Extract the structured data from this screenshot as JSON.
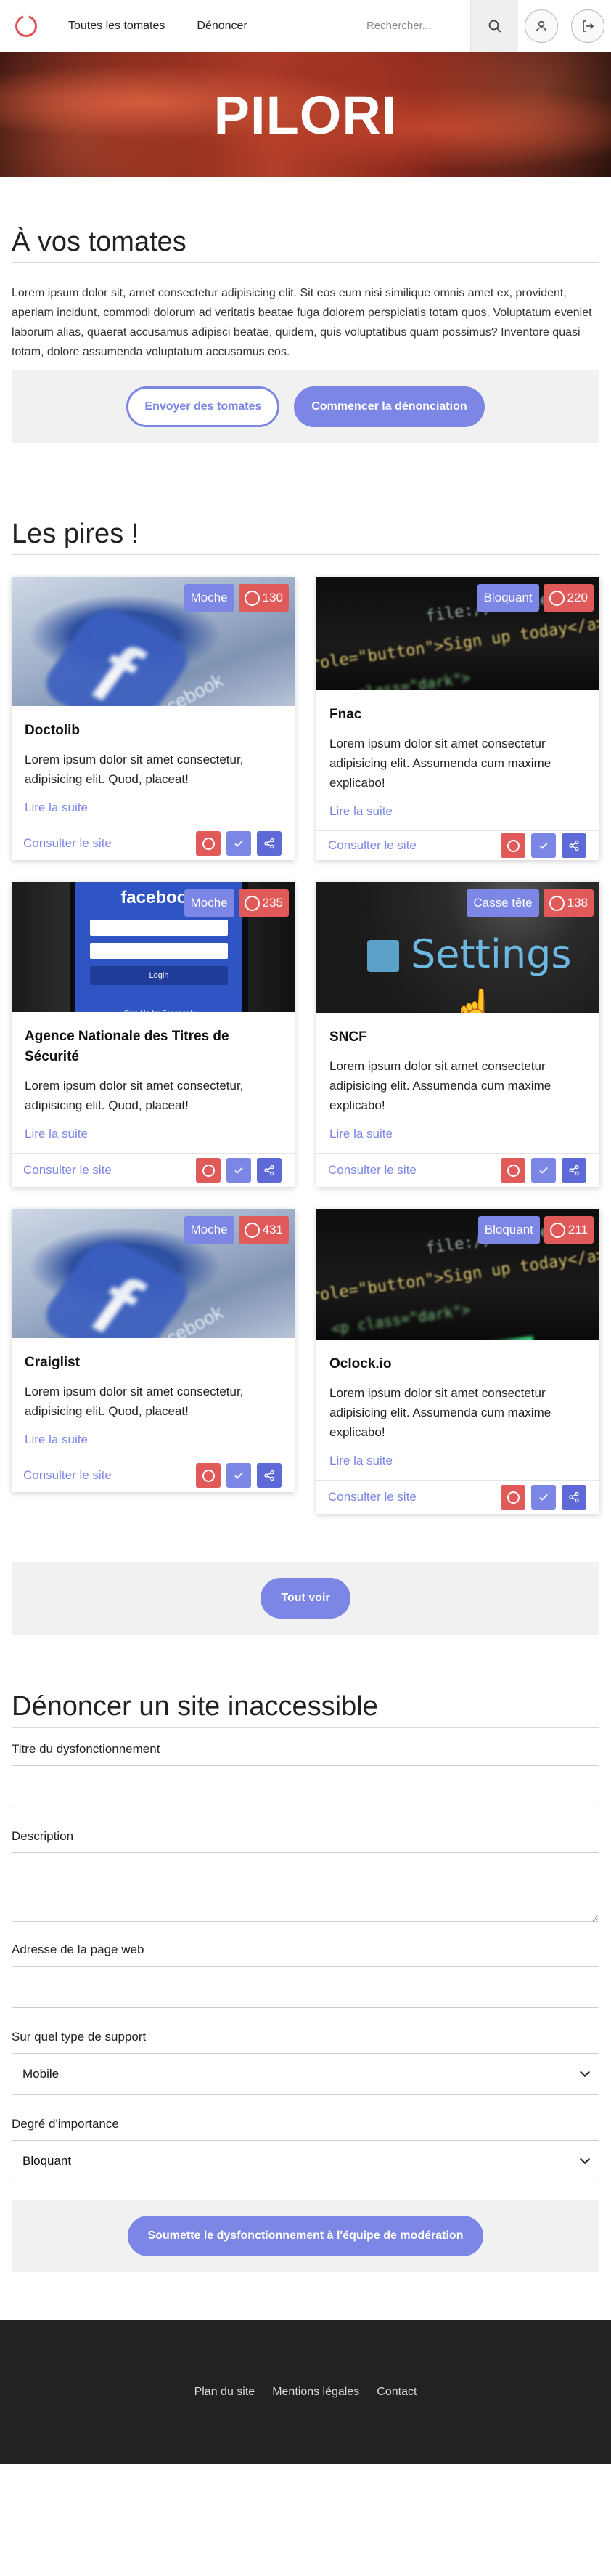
{
  "nav": {
    "links": [
      "Toutes les tomates",
      "Dénoncer"
    ],
    "search_placeholder": "Rechercher..."
  },
  "hero": {
    "title": "PILORI"
  },
  "intro": {
    "title": "À vos tomates",
    "text": "Lorem ipsum dolor sit, amet consectetur adipisicing elit. Sit eos eum nisi similique omnis amet ex, provident, aperiam incidunt, commodi dolorum ad veritatis beatae fuga dolorem perspiciatis totam quos. Voluptatum eveniet laborum alias, quaerat accusamus adipisci beatae, quidem, quis voluptatibus quam possimus? Inventore quasi totam, dolore assumenda voluptatum accusamus eos.",
    "btn_send": "Envoyer des tomates",
    "btn_start": "Commencer la dénonciation"
  },
  "worst": {
    "title": "Les pires !",
    "visit_label": "Consulter le site",
    "more_label": "Lire la suite",
    "see_all": "Tout voir",
    "cards": [
      {
        "title": "Doctolib",
        "category": "Moche",
        "count": "130",
        "desc": "Lorem ipsum dolor sit amet consectetur, adipisicing elit. Quod, placeat!",
        "image": "facebook-logo-photo"
      },
      {
        "title": "Fnac",
        "category": "Bloquant",
        "count": "220",
        "desc": "Lorem ipsum dolor sit amet consectetur adipisicing elit. Assumenda cum maxime explicabo!",
        "image": "code-screen-photo"
      },
      {
        "title": "Agence Nationale des Titres de Sécurité",
        "category": "Moche",
        "count": "235",
        "desc": "Lorem ipsum dolor sit amet consectetur, adipisicing elit. Quod, placeat!",
        "image": "phone-facebook-photo"
      },
      {
        "title": "SNCF",
        "category": "Casse tête",
        "count": "138",
        "desc": "Lorem ipsum dolor sit amet consectetur adipisicing elit. Assumenda cum maxime explicabo!",
        "image": "settings-screen-photo"
      },
      {
        "title": "Craiglist",
        "category": "Moche",
        "count": "431",
        "desc": "Lorem ipsum dolor sit amet consectetur, adipisicing elit. Quod, placeat!",
        "image": "facebook-logo-photo"
      },
      {
        "title": "Oclock.io",
        "category": "Bloquant",
        "count": "211",
        "desc": "Lorem ipsum dolor sit amet consectetur adipisicing elit. Assumenda cum maxime explicabo!",
        "image": "code-screen-photo"
      }
    ]
  },
  "report": {
    "title": "Dénoncer un site inaccessible",
    "label_title": "Titre du dysfonctionnement",
    "label_desc": "Description",
    "label_url": "Adresse de la page web",
    "label_support": "Sur quel type de support",
    "support_value": "Mobile",
    "label_importance": "Degré d'importance",
    "importance_value": "Bloquant",
    "submit": "Soumette le dysfonctionnement à l'équipe de modération"
  },
  "footer": {
    "links": [
      "Plan du site",
      "Mentions légales",
      "Contact"
    ]
  },
  "colors": {
    "accent": "#7c86e4",
    "danger": "#e05a5a",
    "footer": "#222224"
  },
  "code_lines": [
    "file://</code>",
    "role=\"button\">Sign up today</a>",
    "<p class=\"dark\">"
  ]
}
